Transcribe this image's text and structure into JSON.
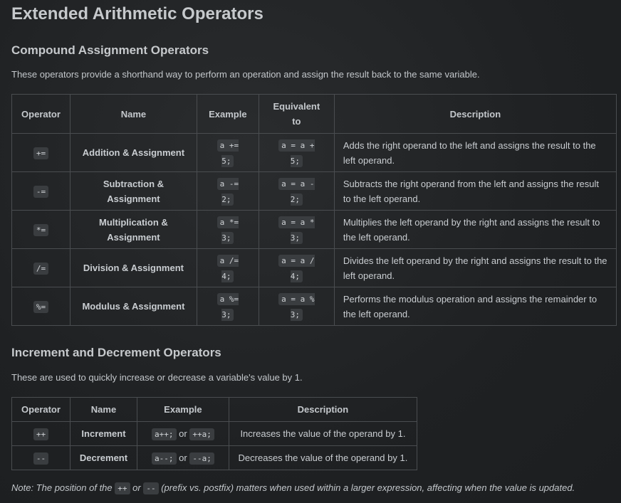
{
  "title": "Extended Arithmetic Operators",
  "compound": {
    "heading": "Compound Assignment Operators",
    "intro": "These operators provide a shorthand way to perform an operation and assign the result back to the same variable.",
    "headers": [
      "Operator",
      "Name",
      "Example",
      "Equivalent to",
      "Description"
    ],
    "rows": [
      {
        "op": "+=",
        "name": "Addition & Assignment",
        "example": "a += 5;",
        "equiv": "a = a + 5;",
        "desc": "Adds the right operand to the left and assigns the result to the left operand."
      },
      {
        "op": "-=",
        "name": "Subtraction & Assignment",
        "example": "a -= 2;",
        "equiv": "a = a - 2;",
        "desc": "Subtracts the right operand from the left and assigns the result to the left operand."
      },
      {
        "op": "*=",
        "name": "Multiplication & Assignment",
        "example": "a *= 3;",
        "equiv": "a = a * 3;",
        "desc": "Multiplies the left operand by the right and assigns the result to the left operand."
      },
      {
        "op": "/=",
        "name": "Division & Assignment",
        "example": "a /= 4;",
        "equiv": "a = a / 4;",
        "desc": "Divides the left operand by the right and assigns the result to the left operand."
      },
      {
        "op": "%=",
        "name": "Modulus & Assignment",
        "example": "a %= 3;",
        "equiv": "a = a % 3;",
        "desc": "Performs the modulus operation and assigns the remainder to the left operand."
      }
    ]
  },
  "incdec": {
    "heading": "Increment and Decrement Operators",
    "intro": "These are used to quickly increase or decrease a variable's value by 1.",
    "headers": [
      "Operator",
      "Name",
      "Example",
      "Description"
    ],
    "rows": [
      {
        "op": "++",
        "name": "Increment",
        "example_a": "a++;",
        "or": "or",
        "example_b": "++a;",
        "desc": "Increases the value of the operand by 1."
      },
      {
        "op": "--",
        "name": "Decrement",
        "example_a": "a--;",
        "or": "or",
        "example_b": "--a;",
        "desc": "Decreases the value of the operand by 1."
      }
    ]
  },
  "note": {
    "prefix": "Note: The position of the",
    "code_a": "++",
    "mid": "or",
    "code_b": "--",
    "suffix": "(prefix vs. postfix) matters when used within a larger expression, affecting when the value is updated."
  }
}
